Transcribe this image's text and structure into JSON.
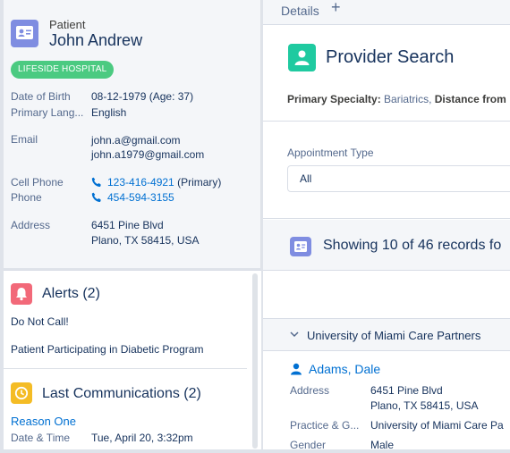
{
  "patient": {
    "type_label": "Patient",
    "name": "John Andrew",
    "badge": "LIFESIDE HOSPITAL",
    "fields": {
      "dob_label": "Date of Birth",
      "dob_value": "08-12-1979 (Age: 37)",
      "lang_label": "Primary Lang...",
      "lang_value": "English",
      "email_label": "Email",
      "email_1": "john.a@gmail.com",
      "email_2": "john.a1979@gmail.com",
      "cell_label": "Cell Phone",
      "cell_value": "123-416-4921",
      "cell_suffix": " (Primary)",
      "phone_label": "Phone",
      "phone_value": "454-594-3155",
      "address_label": "Address",
      "address_line1": "6451 Pine Blvd",
      "address_line2": "Plano, TX 58415, USA"
    }
  },
  "alerts": {
    "title": "Alerts (2)",
    "items": [
      "Do Not Call!",
      "Patient Participating in Diabetic Program"
    ],
    "icon": "bell-icon",
    "icon_color": "#f26979"
  },
  "communications": {
    "title": "Last Communications (2)",
    "item_link": "Reason One",
    "date_label": "Date & Time",
    "date_value": "Tue, April 20, 3:32pm",
    "icon": "clock-icon",
    "icon_color": "#f4bc25"
  },
  "tabs": {
    "details": "Details",
    "add": "+"
  },
  "provider_search": {
    "title": "Provider Search",
    "filter_specialty_label": "Primary Specialty:",
    "filter_specialty_value": " Bariatrics, ",
    "filter_distance_label": "Distance from",
    "appointment_type_label": "Appointment Type",
    "appointment_type_value": "All",
    "showing_text": "Showing 10 of 46 records fo"
  },
  "results": {
    "group_label": "University of Miami Care Partners",
    "provider_name": "Adams, Dale",
    "address_label": "Address",
    "address_line1": "6451 Pine Blvd",
    "address_line2": "Plano, TX 58415, USA",
    "practice_label": "Practice & G...",
    "practice_value": "University of Miami Care Pa",
    "gender_label": "Gender",
    "gender_value": "Male"
  },
  "colors": {
    "link": "#0070d2",
    "badge": "#4bca81",
    "patient_icon": "#7f8de1",
    "provider_icon": "#1fcaa0"
  }
}
